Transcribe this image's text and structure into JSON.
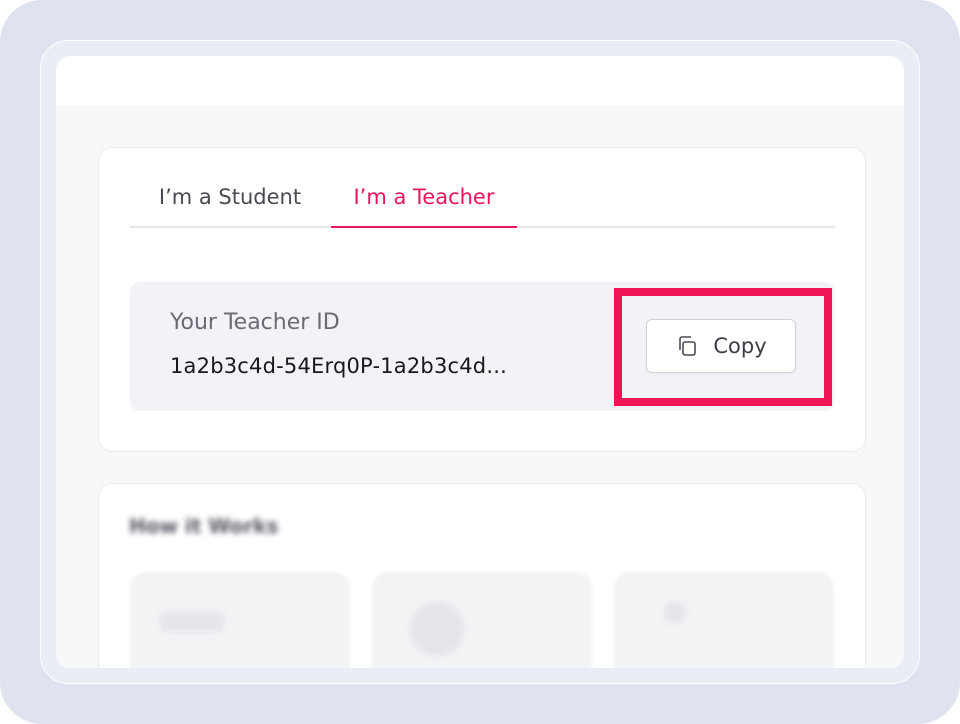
{
  "tabs": {
    "student_label": "I’m a Student",
    "teacher_label": "I’m a Teacher",
    "active": "teacher"
  },
  "teacher_id": {
    "label": "Your Teacher ID",
    "value": "1a2b3c4d-54Erq0P-1a2b3c4d..."
  },
  "copy_button": {
    "label": "Copy",
    "icon": "copy-icon"
  },
  "how_it_works": {
    "title": "How it Works"
  },
  "colors": {
    "accent": "#e8155a",
    "highlight": "#ef1556",
    "frame": "#dfe3ef"
  }
}
